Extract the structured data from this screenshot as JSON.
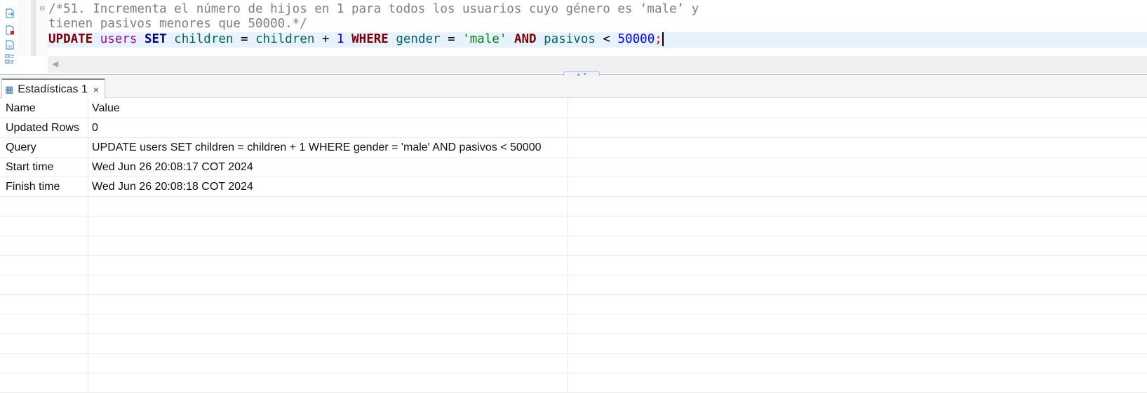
{
  "editor": {
    "comment_line1": "/*51. Incrementa el número de hijos en 1 para todos los usuarios cuyo género es ‘male’ y",
    "comment_line2": "tienen pasivos menores que 50000.*/",
    "sql_tokens": {
      "update": "UPDATE",
      "users": "users",
      "set": "SET",
      "children1": "children",
      "eq1": "=",
      "children2": "children",
      "plus": "+",
      "one": "1",
      "where": "WHERE",
      "gender": "gender",
      "eq2": "=",
      "male": "'male'",
      "and": "AND",
      "pasivos": "pasivos",
      "lt": "<",
      "value": "50000",
      "semi": ";"
    }
  },
  "results_tab": {
    "label": "Estadísticas 1",
    "close": "×"
  },
  "table": {
    "headers": [
      "Name",
      "Value"
    ],
    "rows": [
      [
        "Updated Rows",
        "0"
      ],
      [
        "Query",
        "UPDATE users SET children = children + 1 WHERE gender = 'male' AND pasivos < 50000"
      ],
      [
        "Start time",
        "Wed Jun 26 20:08:17 COT 2024"
      ],
      [
        "Finish time",
        "Wed Jun 26 20:08:18 COT 2024"
      ]
    ]
  }
}
